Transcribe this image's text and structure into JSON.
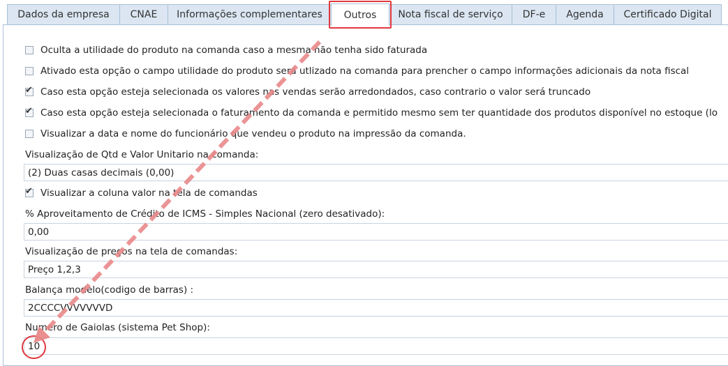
{
  "tabs": [
    {
      "label": "Dados da empresa"
    },
    {
      "label": "CNAE"
    },
    {
      "label": "Informações complementares"
    },
    {
      "label": "Outros"
    },
    {
      "label": "Nota fiscal de serviço"
    },
    {
      "label": "DF-e"
    },
    {
      "label": "Agenda"
    },
    {
      "label": "Certificado Digital"
    }
  ],
  "options": {
    "opt1": {
      "label": "Oculta a utilidade do produto na comanda caso a mesma não tenha sido faturada",
      "checked": false
    },
    "opt2": {
      "label": "Ativado esta opção o campo utilidade do produto será utlizado na comanda para prencher o campo informações adicionais da nota fiscal",
      "checked": false
    },
    "opt3": {
      "label": "Caso esta opção esteja selecionada os valores nas vendas serão arredondados, caso contrario o valor será truncado",
      "checked": true
    },
    "opt4": {
      "label": "Caso esta opção esteja selecionada o faturamento da comanda e permitido mesmo sem ter quantidade dos produtos disponível no estoque (lo",
      "checked": true
    },
    "opt5": {
      "label": "Visualizar a data e nome do funcionário que vendeu o produto na impressão da comanda.",
      "checked": false
    },
    "opt6": {
      "label": "Visualizar a coluna valor na tela de comandas",
      "checked": true
    }
  },
  "fields": {
    "qtd_valor": {
      "label": "Visualização de Qtd e Valor Unitario na comanda:",
      "value": "(2) Duas casas decimais (0,00)"
    },
    "icms": {
      "label": "% Aproveitamento de Crédito de ICMS - Simples Nacional (zero desativado):",
      "value": "0,00"
    },
    "precos": {
      "label": "Visualização de preços na tela de comandas:",
      "value": "Preço 1,2,3"
    },
    "balanca": {
      "label": "Balança modelo(codigo de barras) :",
      "value": "2CCCCVVVVVVVD"
    },
    "gaiolas": {
      "label": "Numero de Gaiolas (sistema Pet Shop):",
      "value": "10"
    }
  },
  "annotation_color": "#e0383e"
}
